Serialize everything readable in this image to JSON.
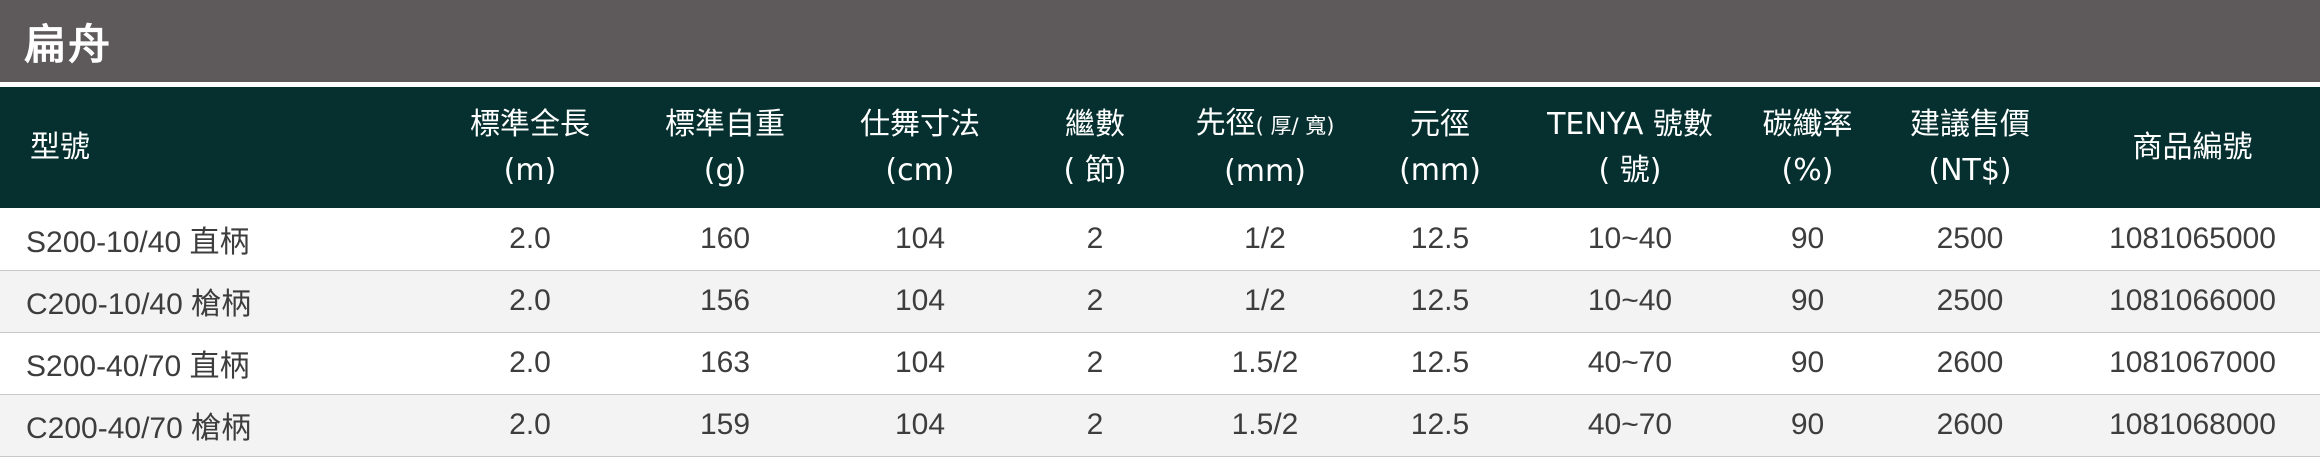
{
  "title": "扁舟",
  "headers": {
    "model": "型號",
    "length_l1": "標準全長",
    "length_l2": "(m)",
    "weight_l1": "標準自重",
    "weight_l2": "(g)",
    "closed_l1": "仕舞寸法",
    "closed_l2": "(cm)",
    "sections_l1": "繼數",
    "sections_l2": "( 節)",
    "tip_l1": "先徑",
    "tip_small": "( 厚/ 寬)",
    "tip_l2": "(mm)",
    "butt_l1": "元徑",
    "butt_l2": "(mm)",
    "tenya_l1": "TENYA 號數",
    "tenya_l2": "( 號)",
    "carbon_l1": "碳纖率",
    "carbon_l2": "(%)",
    "price_l1": "建議售價",
    "price_l2": "(NT$)",
    "code": "商品編號"
  },
  "rows": [
    [
      "S200-10/40 直柄",
      "2.0",
      "160",
      "104",
      "2",
      "1/2",
      "12.5",
      "10~40",
      "90",
      "2500",
      "1081065000"
    ],
    [
      "C200-10/40 槍柄",
      "2.0",
      "156",
      "104",
      "2",
      "1/2",
      "12.5",
      "10~40",
      "90",
      "2500",
      "1081066000"
    ],
    [
      "S200-40/70 直柄",
      "2.0",
      "163",
      "104",
      "2",
      "1.5/2",
      "12.5",
      "40~70",
      "90",
      "2600",
      "1081067000"
    ],
    [
      "C200-40/70 槍柄",
      "2.0",
      "159",
      "104",
      "2",
      "1.5/2",
      "12.5",
      "40~70",
      "90",
      "2600",
      "1081068000"
    ]
  ]
}
